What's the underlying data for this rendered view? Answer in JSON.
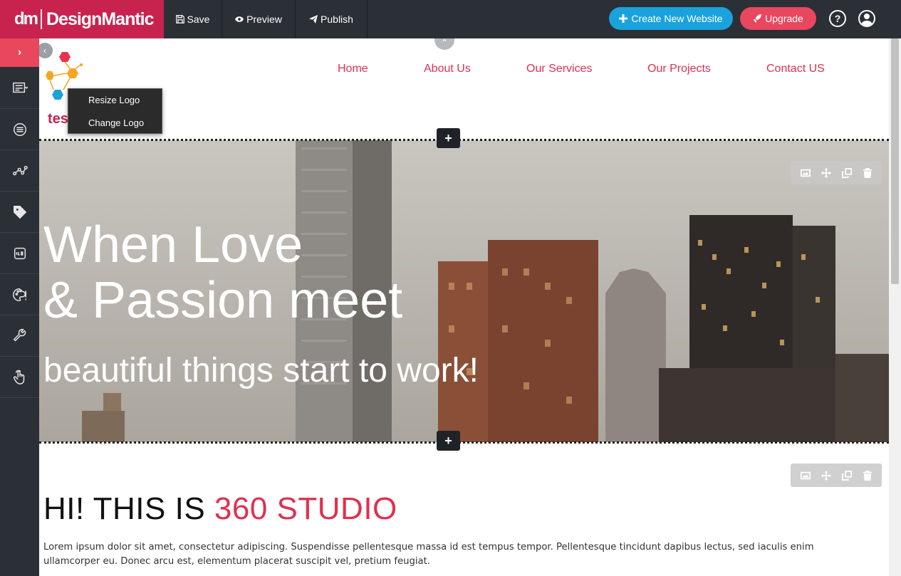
{
  "brand": {
    "mark": "dm",
    "name": "DesignMantic"
  },
  "toolbar": {
    "save": "Save",
    "preview": "Preview",
    "publish": "Publish",
    "create": "Create New Website",
    "upgrade": "Upgrade",
    "help": "?"
  },
  "colors": {
    "brand": "#c8234f",
    "create": "#1aa2dc",
    "upgrade": "#e8475e",
    "accent": "#e0304f",
    "dark": "#2b2f36"
  },
  "sidebar": {
    "toggle": "›",
    "items": [
      "layout-icon",
      "menu-icon",
      "share-icon",
      "tag-icon",
      "favicon-icon",
      "palette-icon",
      "wrench-icon",
      "hand-icon"
    ]
  },
  "site": {
    "logo_text": "tes",
    "nav": [
      "Home",
      "About Us",
      "Our Services",
      "Our Projects",
      "Contact US"
    ],
    "logo_menu": [
      "Resize Logo",
      "Change Logo"
    ],
    "hero": {
      "line1": "When Love",
      "line2": "& Passion meet",
      "sub": "beautiful things start to work!"
    },
    "section": {
      "heading_plain": "HI! THIS IS ",
      "heading_accent": "360 STUDIO",
      "paragraph": "Lorem ipsum dolor sit amet, consectetur adipiscing. Suspendisse pellentesque massa id est tempus tempor. Pellentesque tincidunt dapibus lectus, sed iaculis enim ullamcorper eu. Donec arcu est, elementum placerat suscipit vel, pretium feugiat."
    },
    "add_label": "+"
  }
}
